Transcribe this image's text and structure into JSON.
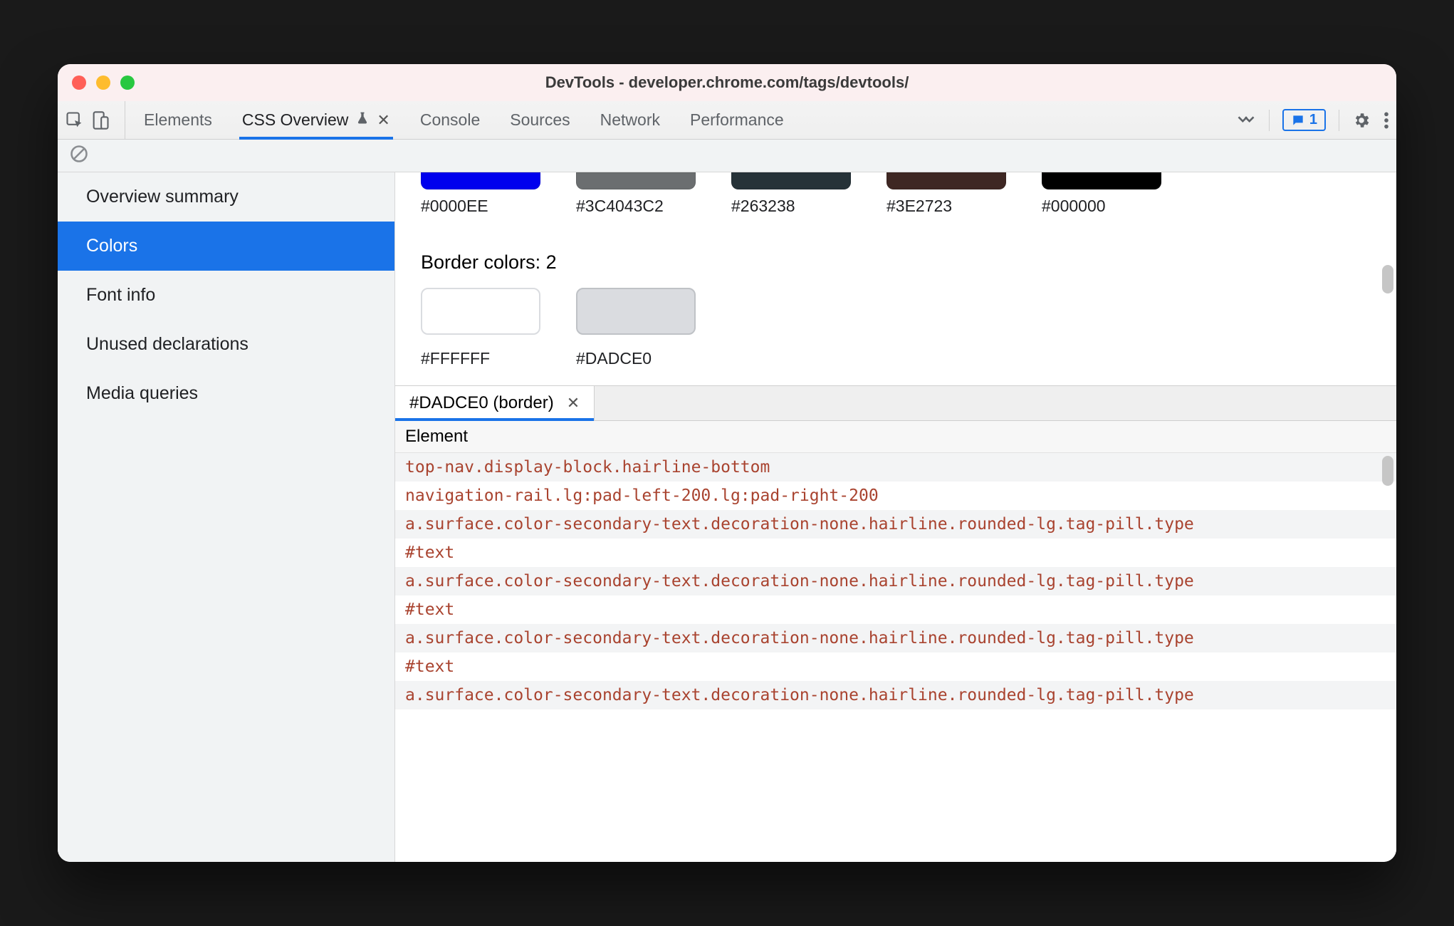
{
  "window": {
    "title": "DevTools - developer.chrome.com/tags/devtools/"
  },
  "tabstrip": {
    "tabs": {
      "elements": "Elements",
      "css_overview": "CSS Overview",
      "console": "Console",
      "sources": "Sources",
      "network": "Network",
      "performance": "Performance"
    },
    "issues_count": "1"
  },
  "sidebar": {
    "items": {
      "overview_summary": "Overview summary",
      "colors": "Colors",
      "font_info": "Font info",
      "unused_declarations": "Unused declarations",
      "media_queries": "Media queries"
    }
  },
  "colors_panel": {
    "row1": [
      {
        "hex": "#0000EE",
        "css": "#0000EE"
      },
      {
        "hex": "#3C4043C2",
        "css": "rgba(60,64,67,0.76)"
      },
      {
        "hex": "#263238",
        "css": "#263238"
      },
      {
        "hex": "#3E2723",
        "css": "#3E2723"
      },
      {
        "hex": "#000000",
        "css": "#000000"
      }
    ],
    "border_section_title": "Border colors: 2",
    "border_colors": [
      {
        "hex": "#FFFFFF",
        "css": "#FFFFFF",
        "border": "#dadce0"
      },
      {
        "hex": "#DADCE0",
        "css": "#DADCE0",
        "border": "#bfc2c6"
      }
    ]
  },
  "detail_panel": {
    "tab_label": "#DADCE0 (border)",
    "header": "Element",
    "rows": [
      "top-nav.display-block.hairline-bottom",
      "navigation-rail.lg:pad-left-200.lg:pad-right-200",
      "a.surface.color-secondary-text.decoration-none.hairline.rounded-lg.tag-pill.type",
      "#text",
      "a.surface.color-secondary-text.decoration-none.hairline.rounded-lg.tag-pill.type",
      "#text",
      "a.surface.color-secondary-text.decoration-none.hairline.rounded-lg.tag-pill.type",
      "#text",
      "a.surface.color-secondary-text.decoration-none.hairline.rounded-lg.tag-pill.type"
    ]
  }
}
